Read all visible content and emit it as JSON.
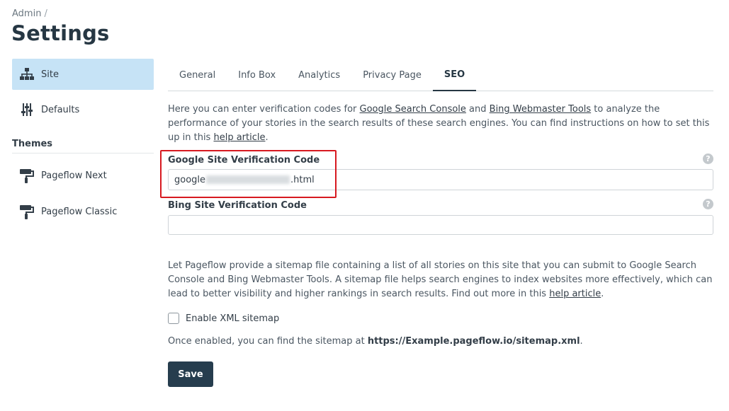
{
  "breadcrumb": {
    "parent": "Admin",
    "separator": "/"
  },
  "page": {
    "title": "Settings"
  },
  "sidebar": {
    "items": [
      {
        "label": "Site",
        "icon": "sitemap-icon",
        "active": true
      },
      {
        "label": "Defaults",
        "icon": "sliders-icon",
        "active": false
      }
    ],
    "section_title": "Themes",
    "themes": [
      {
        "label": "Pageflow Next",
        "icon": "paint-roller-icon"
      },
      {
        "label": "Pageflow Classic",
        "icon": "paint-roller-icon"
      }
    ]
  },
  "tabs": [
    {
      "label": "General",
      "active": false
    },
    {
      "label": "Info Box",
      "active": false
    },
    {
      "label": "Analytics",
      "active": false
    },
    {
      "label": "Privacy Page",
      "active": false
    },
    {
      "label": "SEO",
      "active": true
    }
  ],
  "intro": {
    "text1": "Here you can enter verification codes for ",
    "link1": "Google Search Console",
    "text2": " and ",
    "link2": "Bing Webmaster Tools",
    "text3": " to analyze the performance of your stories in the search results of these search engines. You can find instructions on how to set this up in this ",
    "link3": "help article",
    "text4": "."
  },
  "google_field": {
    "label": "Google Site Verification Code",
    "value_prefix": "google",
    "value_suffix": ".html",
    "help": "?"
  },
  "bing_field": {
    "label": "Bing Site Verification Code",
    "value": "",
    "help": "?"
  },
  "sitemap": {
    "text1": "Let Pageflow provide a sitemap file containing a list of all stories on this site that you can submit to Google Search Console and Bing Webmaster Tools. A sitemap file helps search engines to index websites more effectively, which can lead to better visibility and higher rankings in search results. Find out more in this ",
    "link": "help article",
    "text2": ".",
    "checkbox_label": "Enable XML sitemap",
    "checked": false,
    "note_prefix": "Once enabled, you can find the sitemap at ",
    "note_url": "https://Example.pageflow.io/sitemap.xml",
    "note_suffix": "."
  },
  "actions": {
    "save_label": "Save"
  },
  "colors": {
    "accent": "#263d4e",
    "active_bg": "#c6e3f6",
    "highlight": "#d71920"
  }
}
